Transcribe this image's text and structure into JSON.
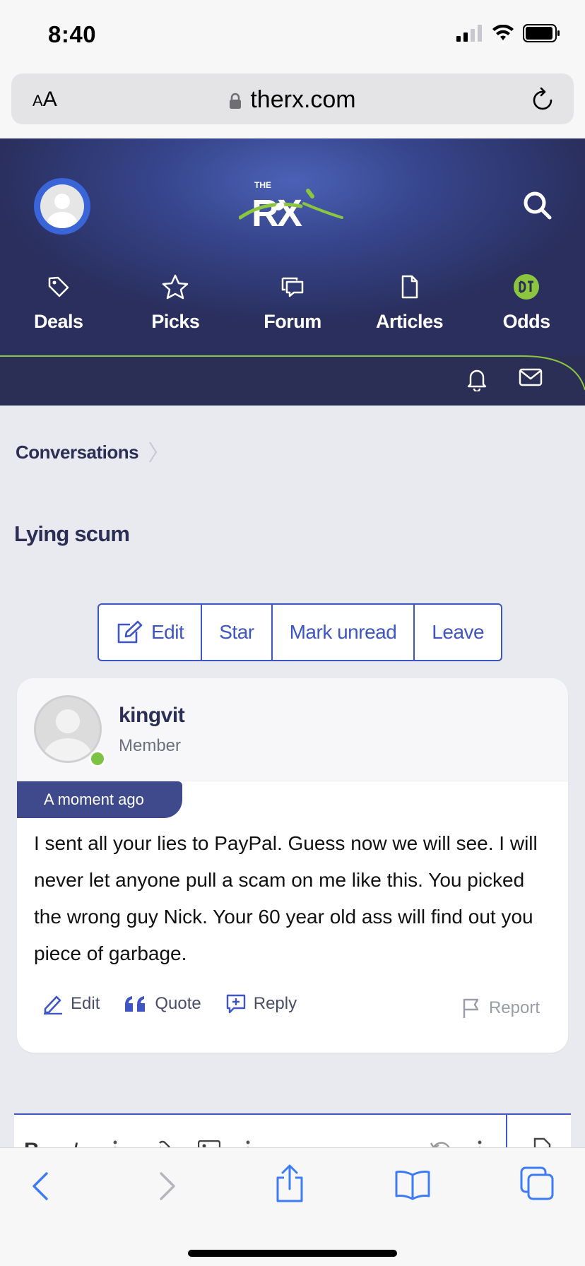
{
  "status": {
    "time": "8:40"
  },
  "browser": {
    "text_size_label_small": "A",
    "text_size_label_large": "A",
    "url": "therx.com"
  },
  "header": {
    "logo_text_top": "THE",
    "logo_text": "RX",
    "nav": [
      {
        "label": "Deals",
        "icon": "tag-icon"
      },
      {
        "label": "Picks",
        "icon": "star-icon"
      },
      {
        "label": "Forum",
        "icon": "chat-icon"
      },
      {
        "label": "Articles",
        "icon": "document-icon"
      },
      {
        "label": "Odds",
        "icon": "odds-icon"
      }
    ],
    "accent_color": "#8cc63f"
  },
  "breadcrumb": {
    "label": "Conversations"
  },
  "page": {
    "title": "Lying scum"
  },
  "actions": {
    "edit": "Edit",
    "star": "Star",
    "mark_unread": "Mark unread",
    "leave": "Leave"
  },
  "message": {
    "username": "kingvit",
    "role": "Member",
    "time": "A moment ago",
    "body": "I sent all your lies to PayPal. Guess now we will see. I will never let anyone pull a scam on me like this. You picked the wrong guy Nick. Your 60 year old ass will find out you piece of garbage.",
    "edit_label": "Edit",
    "quote_label": "Quote",
    "reply_label": "Reply",
    "report_label": "Report"
  },
  "editor": {
    "bold": "B",
    "italic": "I"
  }
}
